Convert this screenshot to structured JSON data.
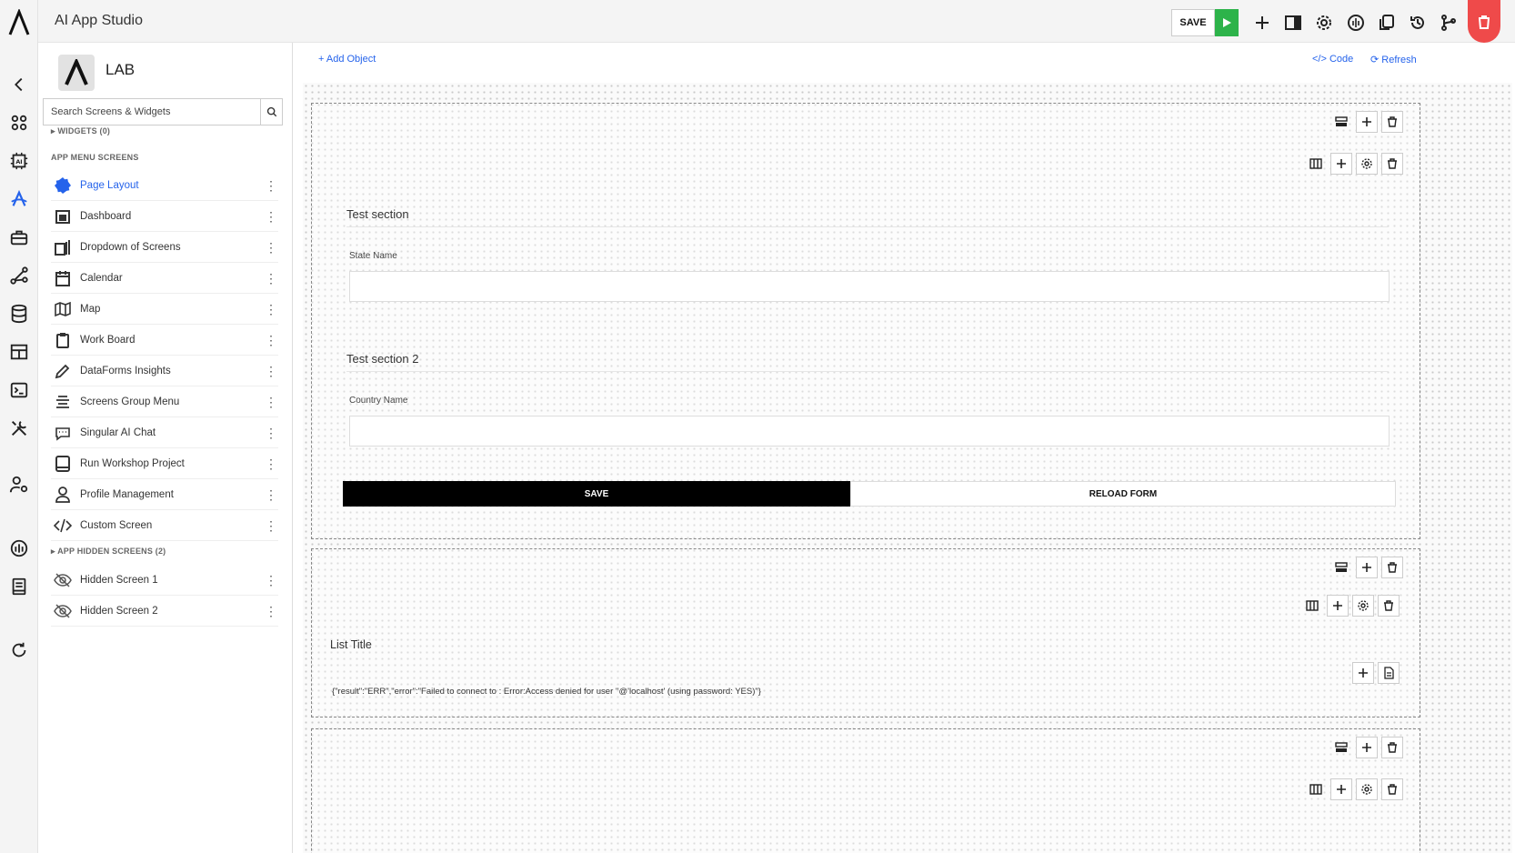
{
  "app": {
    "title": "AI App Studio"
  },
  "topbar": {
    "save_label": "SAVE"
  },
  "sidebar": {
    "title": "LAB",
    "search_placeholder": "Search Screens & Widgets",
    "widgets_group": "WIDGETS (0)",
    "menu_group": "APP MENU SCREENS",
    "hidden_group": "APP HIDDEN SCREENS (2)",
    "menu_items": [
      {
        "label": "Page Layout"
      },
      {
        "label": "Dashboard"
      },
      {
        "label": "Dropdown of Screens"
      },
      {
        "label": "Calendar"
      },
      {
        "label": "Map"
      },
      {
        "label": "Work Board"
      },
      {
        "label": "DataForms Insights"
      },
      {
        "label": "Screens Group Menu"
      },
      {
        "label": "Singular AI Chat"
      },
      {
        "label": "Run Workshop Project"
      },
      {
        "label": "Profile Management"
      },
      {
        "label": "Custom Screen"
      }
    ],
    "hidden_items": [
      {
        "label": "Hidden Screen 1"
      },
      {
        "label": "Hidden Screen 2"
      }
    ],
    "dots": "⋮"
  },
  "main": {
    "add_object": "+ Add Object",
    "code": "</> Code",
    "refresh": "Refresh"
  },
  "form": {
    "section1_title": "Test section",
    "field1_label": "State Name",
    "section2_title": "Test section 2",
    "field2_label": "Country Name",
    "save_button": "SAVE",
    "reload_button": "RELOAD FORM"
  },
  "list": {
    "title": "List Title",
    "error_text": "{\"result\":\"ERR\",\"error\":\"Failed to connect to : Error:Access denied for user ''@'localhost' (using password: YES)\"}"
  },
  "colors": {
    "accent": "#2563eb",
    "play": "#2db34a",
    "delete": "#ef4a4a"
  }
}
